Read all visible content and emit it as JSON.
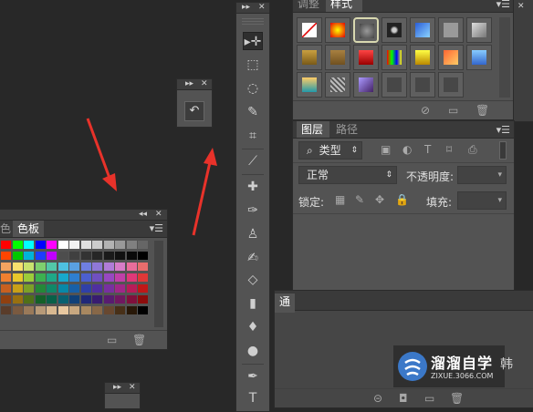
{
  "swatches_panel": {
    "tab_partial": "色",
    "tab_active": "色板",
    "collapse_glyph": "◂◂",
    "close_glyph": "✕",
    "menu_glyph": "▾☰",
    "colors": [
      [
        "#ff0000",
        "#00ff00",
        "#00ffff",
        "#0000ff",
        "#ff00ff",
        "#ffffff",
        "#f2f2f2",
        "#e0e0e0",
        "#cccccc",
        "#b3b3b3",
        "#999999",
        "#808080",
        "#666666"
      ],
      [
        "#ff4500",
        "#00c800",
        "#00b4d8",
        "#1e3cff",
        "#c000ff",
        "#4d4d4d",
        "#404040",
        "#333333",
        "#262626",
        "#1a1a1a",
        "#111111",
        "#0a0a0a",
        "#000000"
      ],
      [
        "#f4a460",
        "#f7e06e",
        "#c9e26e",
        "#7ecf6e",
        "#52c7a8",
        "#4ec0e0",
        "#5aa0e0",
        "#6f7fe0",
        "#8f78d8",
        "#b07cd8",
        "#d77cc8",
        "#e86d9b",
        "#e86d6d"
      ],
      [
        "#f08030",
        "#e8c82c",
        "#9ccc3a",
        "#3cb050",
        "#1fa888",
        "#18a8cc",
        "#2f7fd0",
        "#4c5fd0",
        "#7050c0",
        "#9848c0",
        "#c040a8",
        "#e03878",
        "#e03838"
      ],
      [
        "#c86020",
        "#c8a018",
        "#7ca028",
        "#248838",
        "#108868",
        "#0888a8",
        "#1860a8",
        "#3040a8",
        "#5030a0",
        "#7830a0",
        "#a02888",
        "#b81c58",
        "#c01818"
      ],
      [
        "#904010",
        "#987010",
        "#507018",
        "#146028",
        "#086048",
        "#086070",
        "#104078",
        "#202878",
        "#381c70",
        "#581c70",
        "#701860",
        "#80103c",
        "#8c0c0c"
      ],
      [
        "#5a3c2a",
        "#7a5a40",
        "#9a7a5a",
        "#b89a78",
        "#d8b890",
        "#e8c8a0",
        "#c8a880",
        "#a88860",
        "#886848",
        "#684830",
        "#483018",
        "#281808",
        "#000000"
      ]
    ]
  },
  "styles_panel": {
    "tab_adjust": "调整",
    "tab_styles": "样式",
    "collapse_glyph": "▸▸",
    "close_glyph": "✕",
    "menu_glyph": "▾☰",
    "delete_icon": "🗑",
    "new_icon": "▭",
    "clear_icon": "⊘"
  },
  "layers_panel": {
    "tab_layers": "图层",
    "tab_paths": "路径",
    "menu_glyph": "▾☰",
    "filter_label": "类型",
    "blend_mode": "正常",
    "opacity_label": "不透明度:",
    "lock_label": "锁定:",
    "fill_label": "填充:",
    "footer_icons": [
      "⊝",
      "fx",
      "◘",
      "◐",
      "▤",
      "▭",
      "🗑"
    ]
  },
  "tools_panel": {
    "collapse_glyph": "▸▸",
    "close_glyph": "✕",
    "tools": [
      "▸✛",
      "⬚",
      "◌",
      "✎",
      "⌗",
      "⟋",
      "✚",
      "✑",
      "♙",
      "✍",
      "◇",
      "▮",
      "♦",
      "●",
      "✒",
      "T"
    ]
  },
  "history_panel": {
    "collapse_glyph": "▸▸",
    "close_glyph": "✕",
    "icon": "↶"
  },
  "lower_panel": {
    "tab_partial": "通"
  },
  "watermark": {
    "title": "溜溜自学",
    "url": "ZIXUE.3066.COM",
    "extra_char": "韩"
  },
  "colors": {
    "arrow": "#e8322a",
    "panel_bg": "#535353",
    "app_bg": "#282828"
  }
}
